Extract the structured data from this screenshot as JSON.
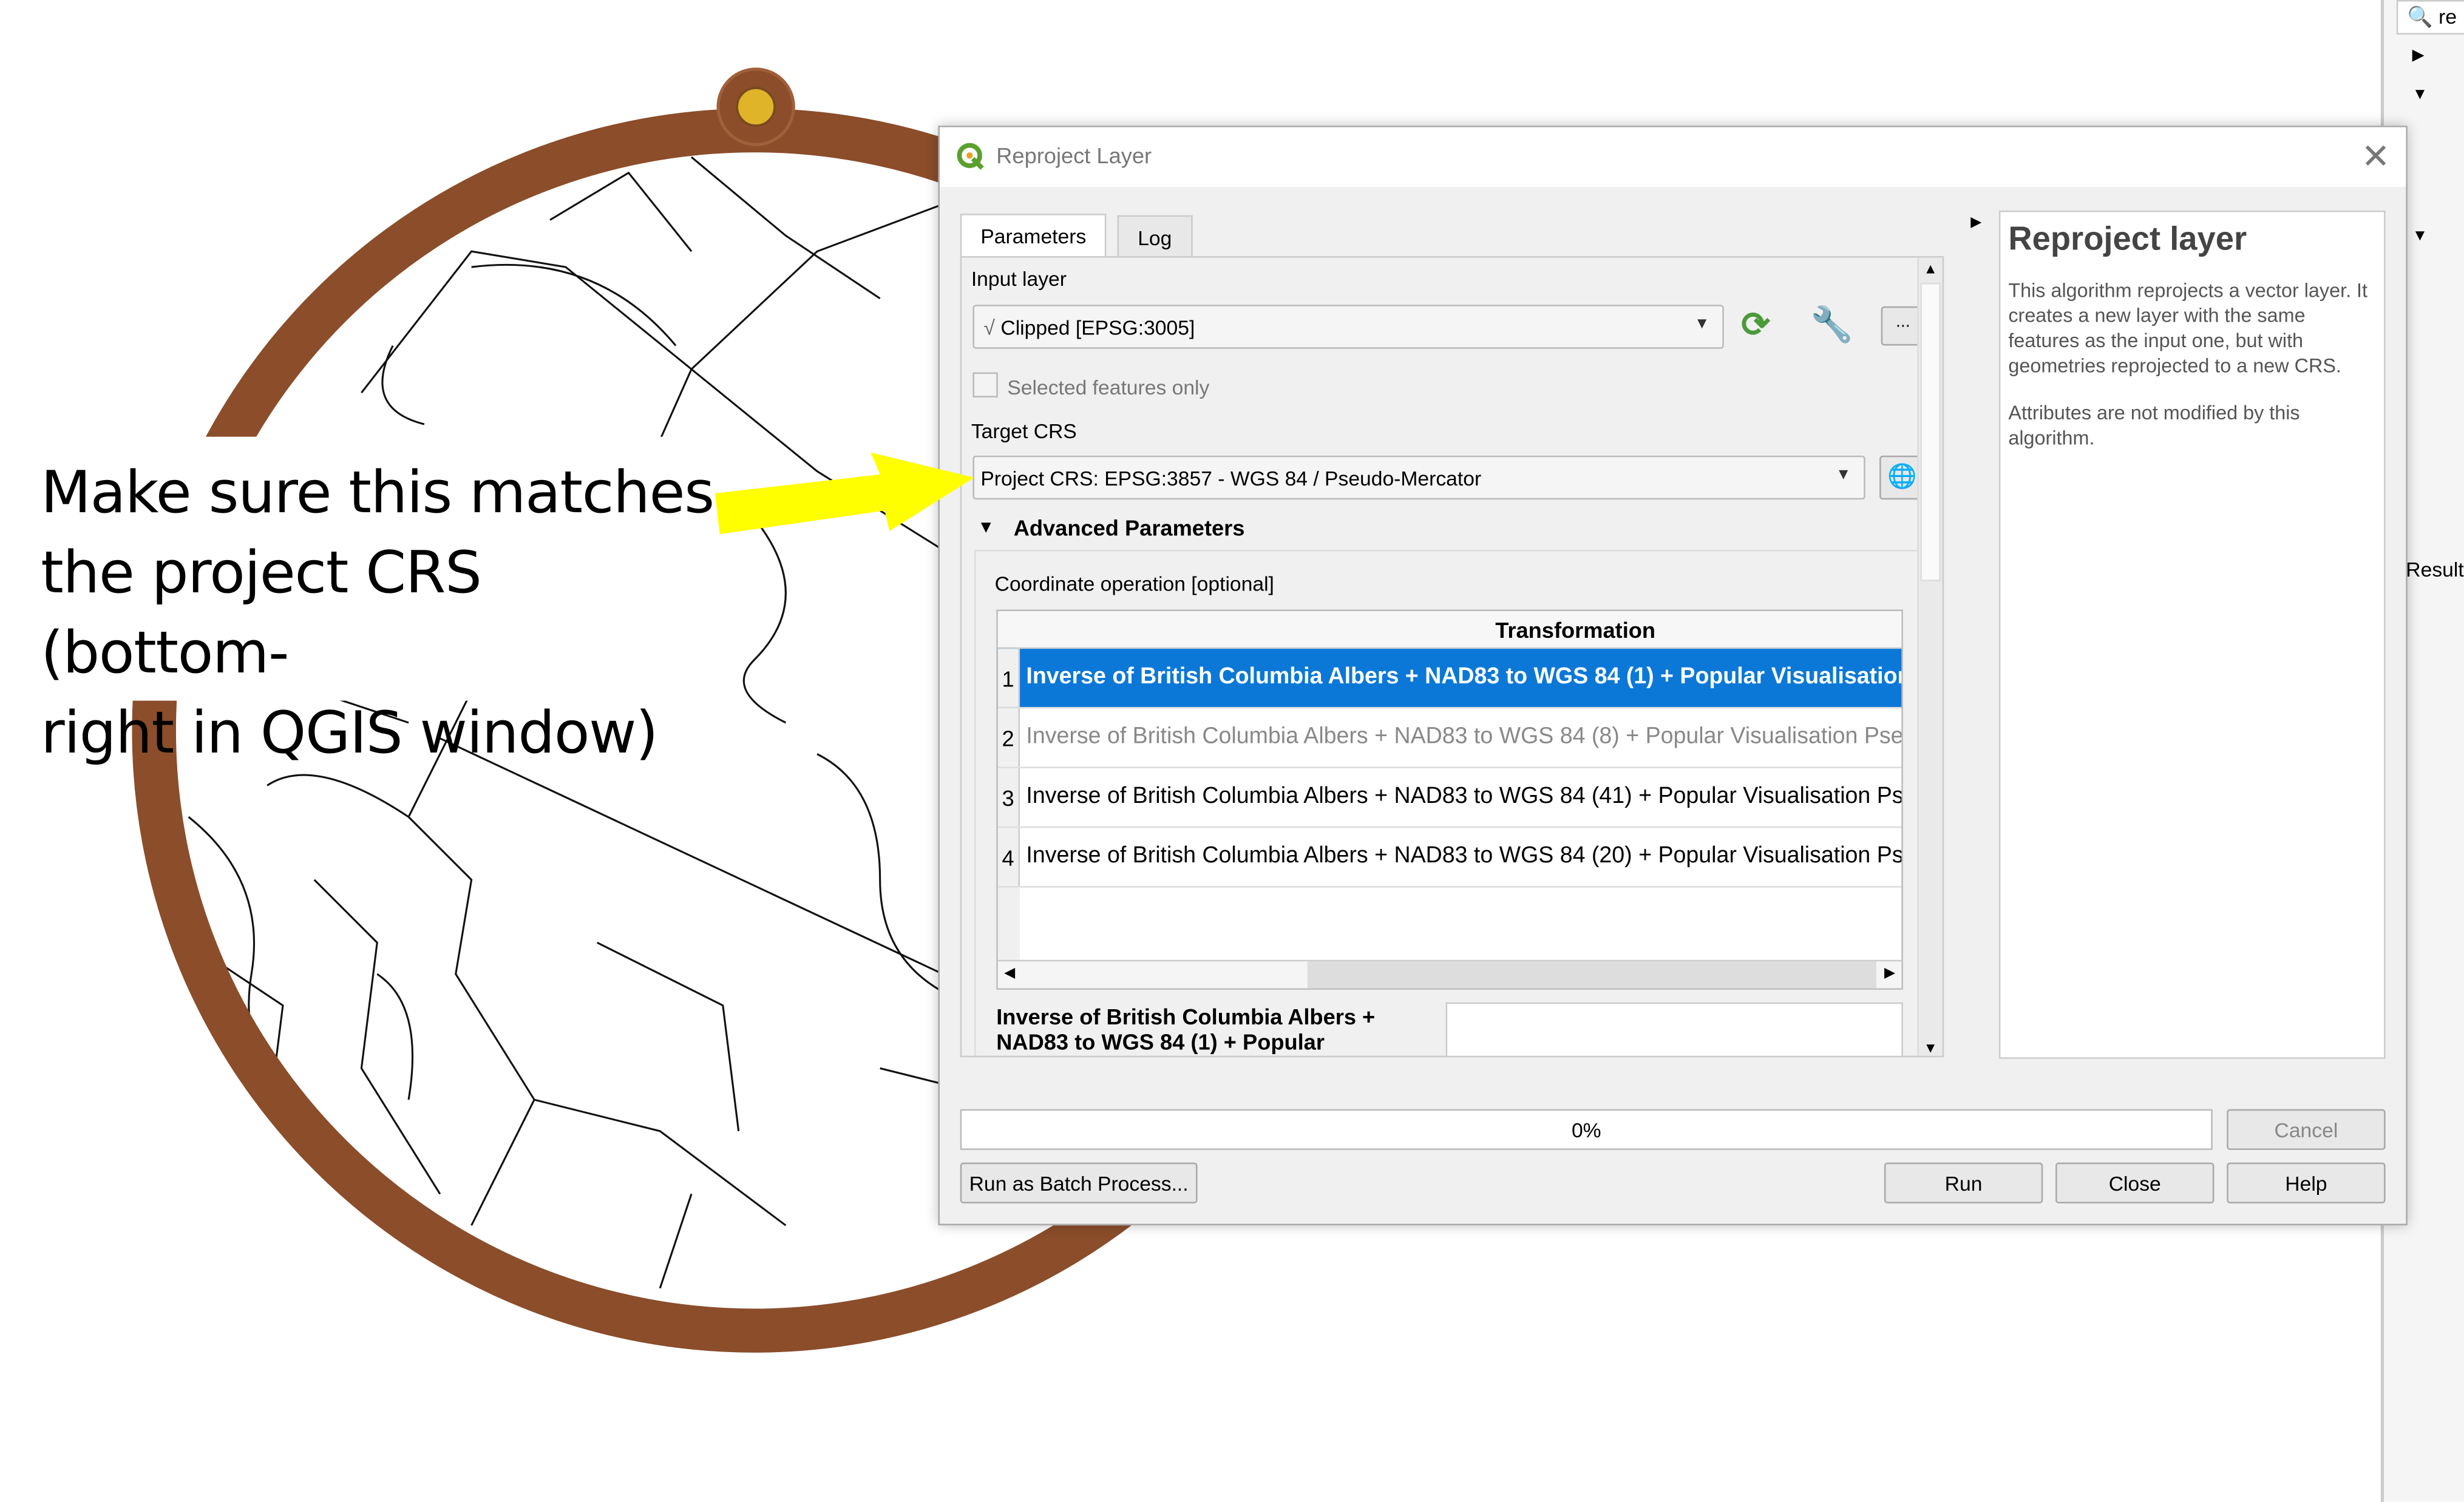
{
  "annotation": {
    "text_lines": [
      "Make sure this matches",
      "the project CRS (bottom-",
      "right in QGIS window)"
    ],
    "arrow_color": "#ffff00"
  },
  "map": {
    "ring_color": "#8b4d2a",
    "knob_color": "#e0b428"
  },
  "dialog": {
    "title": "Reproject Layer",
    "tabs": [
      {
        "label": "Parameters",
        "active": true
      },
      {
        "label": "Log",
        "active": false
      }
    ],
    "input_layer": {
      "label": "Input layer",
      "value": "Clipped [EPSG:3005]",
      "more_button": "...",
      "selected_only_label": "Selected features only",
      "selected_only_checked": false
    },
    "target_crs": {
      "label": "Target CRS",
      "value": "Project CRS: EPSG:3857 - WGS 84 / Pseudo-Mercator"
    },
    "advanced": {
      "label": "Advanced Parameters",
      "coord_op_label": "Coordinate operation [optional]",
      "table": {
        "header": "Transformation",
        "rows": [
          {
            "n": "1",
            "text": "Inverse of British Columbia Albers + NAD83 to WGS 84 (1) + Popular Visualisation Pseudo-Mercator",
            "selected": true,
            "disabled": false
          },
          {
            "n": "2",
            "text": "Inverse of British Columbia Albers + NAD83 to WGS 84 (8) + Popular Visualisation Pseudo-Mercator",
            "selected": false,
            "disabled": true
          },
          {
            "n": "3",
            "text": "Inverse of British Columbia Albers + NAD83 to WGS 84 (41) + Popular Visualisation Pseudo-Mercator",
            "selected": false,
            "disabled": false
          },
          {
            "n": "4",
            "text": "Inverse of British Columbia Albers + NAD83 to WGS 84 (20) + Popular Visualisation Pseudo-Mercator",
            "selected": false,
            "disabled": false
          }
        ]
      },
      "selected_name": "Inverse of British Columbia Albers + NAD83 to WGS 84 (1) + Popular"
    },
    "help": {
      "title": "Reproject layer",
      "p1": "This algorithm reprojects a vector layer. It creates a new layer with the same features as the input one, but with geometries reprojected to a new CRS.",
      "p2": "Attributes are not modified by this algorithm."
    },
    "progress": {
      "value": 0,
      "label": "0%"
    },
    "buttons": {
      "batch": "Run as Batch Process...",
      "cancel": "Cancel",
      "run": "Run",
      "close": "Close",
      "help": "Help"
    },
    "selection_color": "#0b78d7"
  },
  "side_panel": {
    "search_text": "re",
    "results_label": "Result"
  }
}
